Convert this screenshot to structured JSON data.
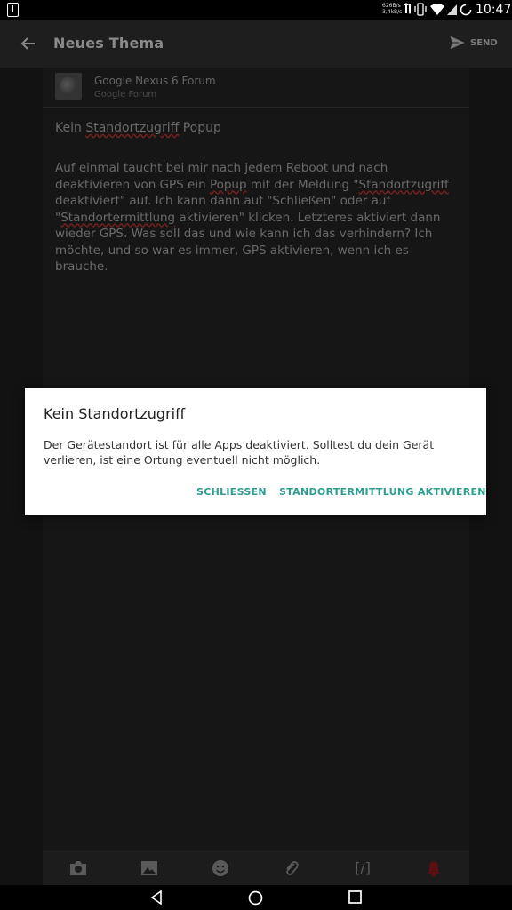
{
  "status_bar": {
    "time": "10:47",
    "speed_top": "626B/s",
    "speed_bottom": "3,4kB/s"
  },
  "toolbar": {
    "title": "Neues Thema",
    "send_label": "SEND"
  },
  "forum": {
    "name": "Google Nexus 6 Forum",
    "subtitle": "Google Forum"
  },
  "post": {
    "title_prefix": "Kein ",
    "title_misspelled": "Standortzugriff",
    "title_suffix": " Popup",
    "body_part1": "Auf einmal taucht bei mir nach jedem Reboot und nach deaktivieren von GPS ein ",
    "body_word_popup": "Popup",
    "body_part2": " mit der Meldung \"",
    "body_word_standortzugriff": "Standortzugriff",
    "body_part3": " deaktiviert\" auf. Ich kann dann auf \"Schließen\" oder auf \"",
    "body_word_standortermittlung": "Standortermittlung",
    "body_part4": " aktivieren\" klicken. Letzteres aktiviert dann wieder GPS. Was soll das und wie kann ich das verhindern? Ich möchte, und so war es immer, GPS aktivieren, wenn ich es brauche."
  },
  "dialog": {
    "title": "Kein Standortzugriff",
    "message": "Der Gerätestandort ist für alle Apps deaktiviert. Solltest du dein Gerät verlieren, ist eine Ortung eventuell nicht möglich.",
    "close_label": "SCHLIESSEN",
    "activate_label": "STANDORTERMITTLUNG AKTIVIEREN"
  },
  "format_bar": {
    "code_label": "[/]"
  },
  "colors": {
    "accent": "#2a9d8f",
    "dim_background": "#121212",
    "dialog_background": "#ffffff"
  }
}
